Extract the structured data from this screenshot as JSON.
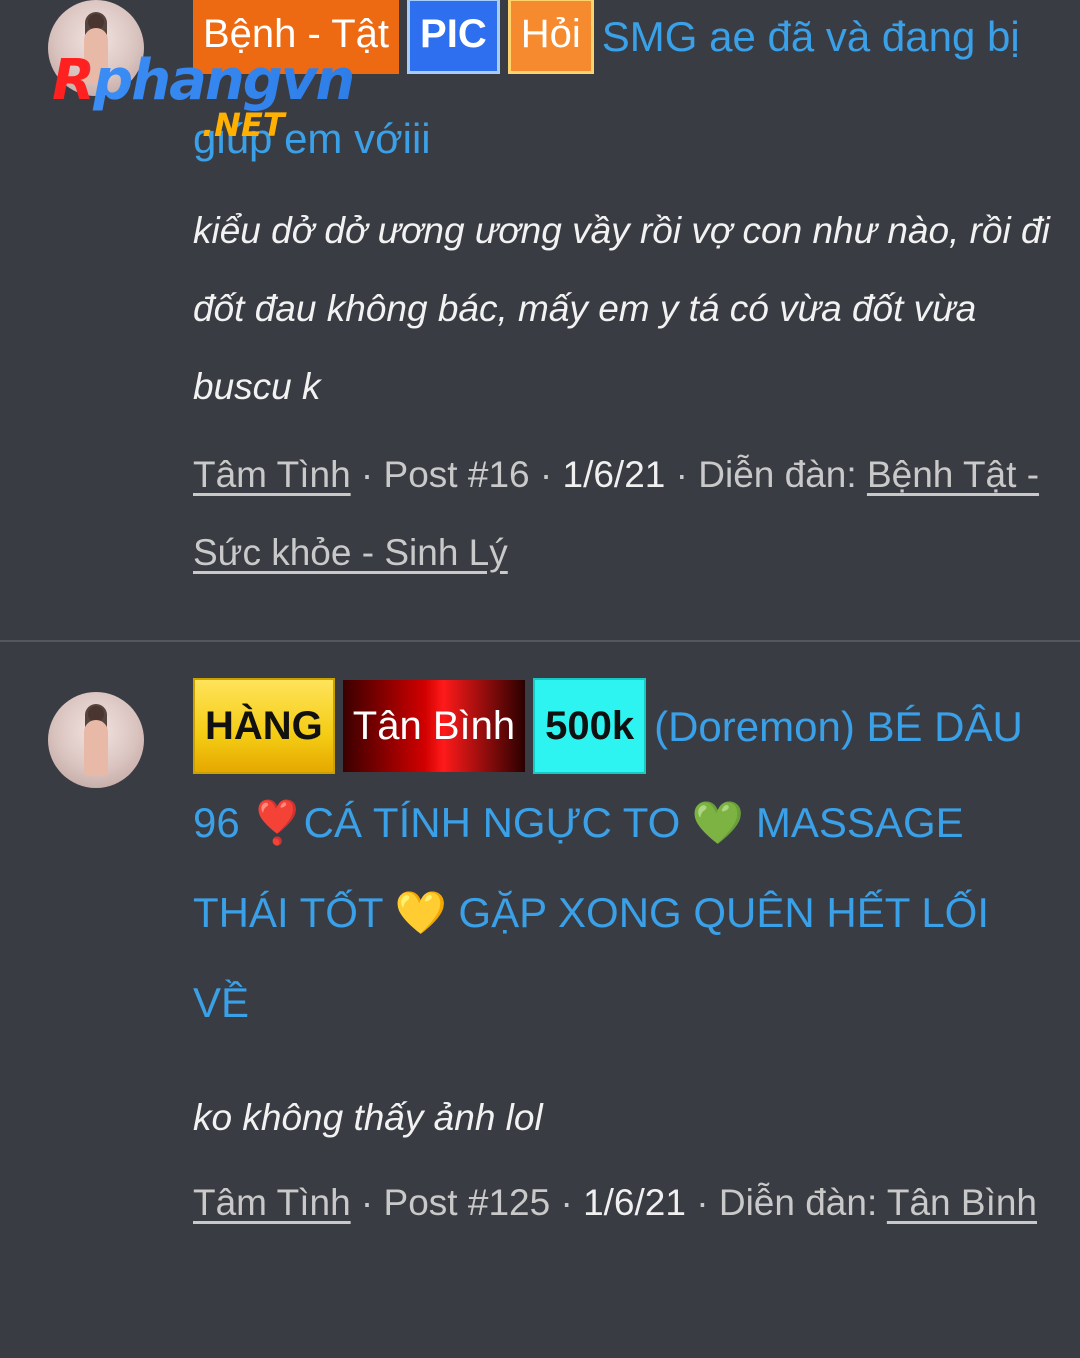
{
  "logo": {
    "word": "Rphangvn",
    "suffix": ".NET"
  },
  "results": [
    {
      "badges": [
        {
          "label": "Bệnh - Tật"
        },
        {
          "label": "PIC"
        },
        {
          "label": "Hỏi"
        }
      ],
      "title": "SMG ae đã và đang bị giúp em vớiii",
      "snippet": "kiểu dở dở ương ương vầy rồi vợ con như nào, rồi đi đốt đau không bác, mấy em y tá có vừa đốt vừa buscu k",
      "meta": {
        "author": "Tâm Tình",
        "post": "Post #16",
        "date": "1/6/21",
        "forum_label": "Diễn đàn:",
        "forum": "Bệnh Tật - Sức khỏe - Sinh Lý"
      }
    },
    {
      "badges": [
        {
          "label": "HÀNG"
        },
        {
          "label": "Tân Bình"
        },
        {
          "label": "500k"
        }
      ],
      "title": "(Doremon) BÉ DÂU 96 ❣️CÁ TÍNH NGỰC TO 💚 MASSAGE THÁI TỐT 💛 GẶP XONG QUÊN HẾT LỐI VỀ",
      "snippet": "ko không thấy ảnh lol",
      "meta": {
        "author": "Tâm Tình",
        "post": "Post #125",
        "date": "1/6/21",
        "forum_label": "Diễn đàn:",
        "forum": "Tân Bình"
      }
    }
  ]
}
